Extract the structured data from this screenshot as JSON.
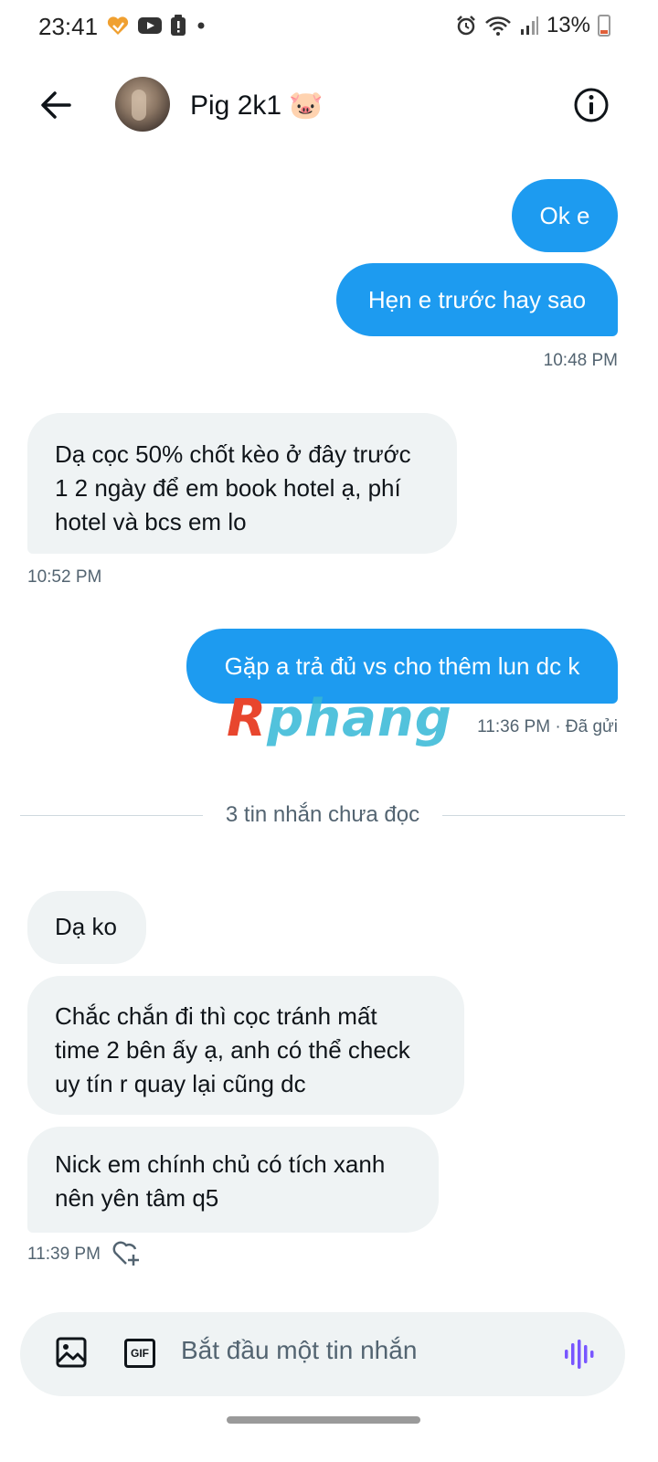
{
  "status_bar": {
    "time": "23:41",
    "battery_pct": "13%",
    "left_icons": [
      "heart-app-icon",
      "youtube-icon",
      "alert-icon",
      "dot-icon"
    ],
    "right_icons": [
      "alarm-icon",
      "wifi-icon",
      "signal-icon",
      "battery-icon"
    ]
  },
  "header": {
    "title": "Pig 2k1 🐷",
    "back_icon": "arrow-left-icon",
    "info_icon": "info-icon"
  },
  "messages": [
    {
      "side": "out",
      "text": "Ok e"
    },
    {
      "side": "out",
      "text": "Hẹn e trước hay sao",
      "time": "10:48 PM"
    },
    {
      "side": "in",
      "text_lines": [
        "Dạ cọc 50% chốt kèo ở đây trước",
        "1 2 ngày để em book hotel ạ, phí",
        "hotel và bcs em lo"
      ],
      "time": "10:52 PM"
    },
    {
      "side": "out",
      "text": "Gặp a trả đủ vs cho thêm lun dc k",
      "time": "11:36 PM · Đã gửi"
    },
    {
      "side": "in",
      "text": "Dạ ko"
    },
    {
      "side": "in",
      "text_lines": [
        "Chắc chắn đi thì cọc tránh mất",
        "time 2 bên ấy ạ, anh có thể check",
        "uy tín r quay lại cũng dc"
      ]
    },
    {
      "side": "in",
      "text_lines": [
        "Nick em chính chủ có tích xanh",
        "nên yên tâm q5"
      ],
      "time": "11:39 PM"
    }
  ],
  "watermark": {
    "first": "R",
    "rest": "phang"
  },
  "unread_divider": "3 tin nhắn chưa đọc",
  "composer": {
    "placeholder": "Bắt đầu một tin nhắn",
    "gif_label": "GIF",
    "icons": [
      "image-icon",
      "gif-icon",
      "voice-icon"
    ]
  },
  "colors": {
    "accent": "#1d9bf0",
    "incoming_bg": "#eff3f4",
    "muted": "#536471",
    "voice": "#7856ff"
  }
}
